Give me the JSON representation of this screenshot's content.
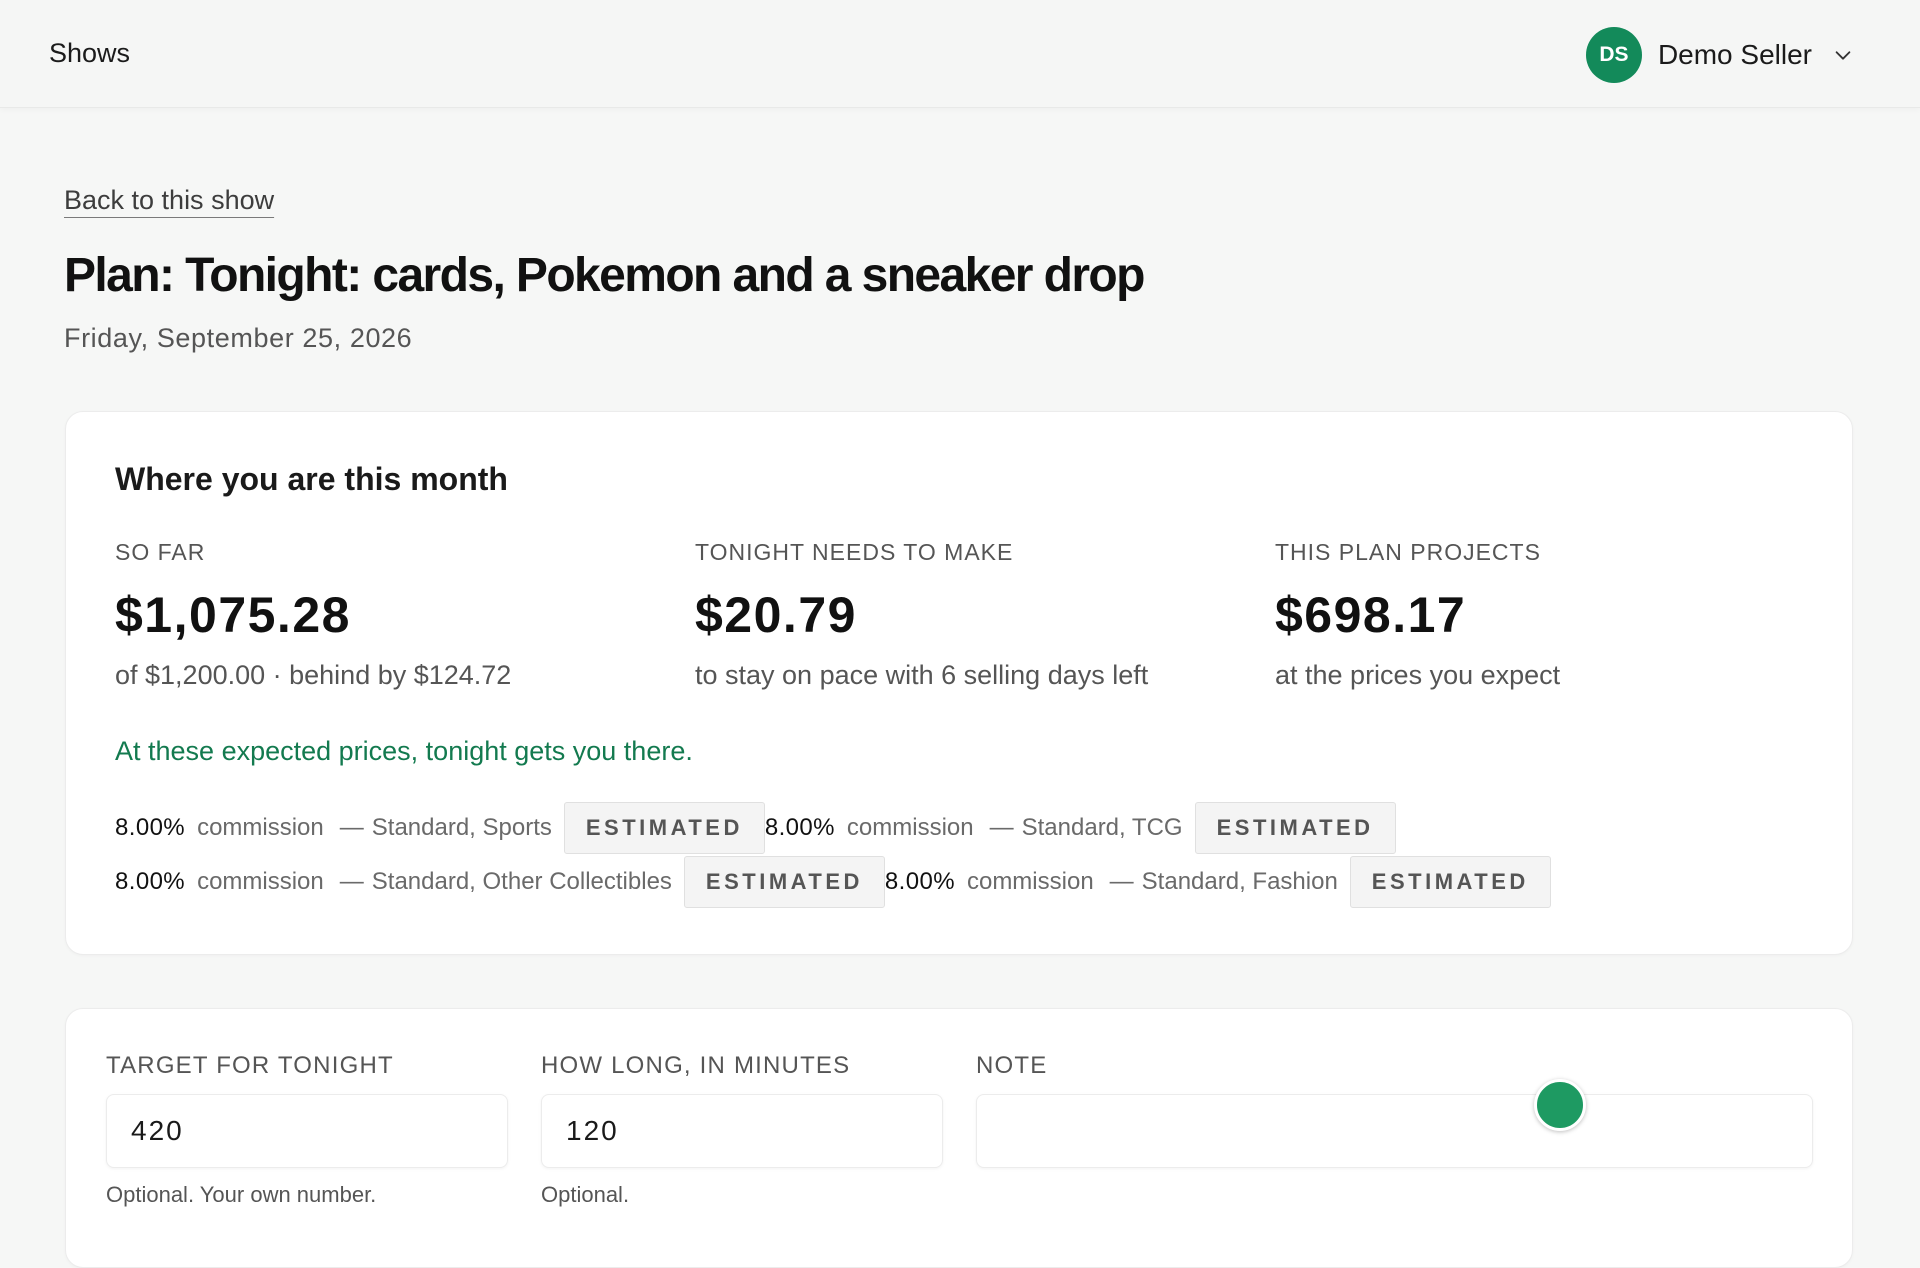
{
  "topbar": {
    "nav_label": "Shows",
    "user": {
      "initials": "DS",
      "name": "Demo Seller"
    },
    "colors": {
      "avatar": "#138a5a"
    }
  },
  "page": {
    "back_link": "Back to this show",
    "title": "Plan: Tonight: cards, Pokemon and a sneaker drop",
    "date": "Friday, September 25, 2026"
  },
  "month": {
    "heading": "Where you are this month",
    "stats": [
      {
        "label": "SO FAR",
        "value": "$1,075.28",
        "sub": "of $1,200.00 · behind by $124.72"
      },
      {
        "label": "TONIGHT NEEDS TO MAKE",
        "value": "$20.79",
        "sub": "to stay on pace with 6 selling days left"
      },
      {
        "label": "THIS PLAN PROJECTS",
        "value": "$698.17",
        "sub": "at the prices you expect"
      }
    ],
    "status": "At these expected prices, tonight gets you there.",
    "status_color": "#137a4f",
    "commissions": [
      {
        "pct": "8.00%",
        "word": "commission",
        "dash": "—",
        "category": "Standard, Sports",
        "badge": "ESTIMATED"
      },
      {
        "pct": "8.00%",
        "word": "commission",
        "dash": "—",
        "category": "Standard, TCG",
        "badge": "ESTIMATED"
      },
      {
        "pct": "8.00%",
        "word": "commission",
        "dash": "—",
        "category": "Standard, Other Collectibles",
        "badge": "ESTIMATED"
      },
      {
        "pct": "8.00%",
        "word": "commission",
        "dash": "—",
        "category": "Standard, Fashion",
        "badge": "ESTIMATED"
      }
    ]
  },
  "form": {
    "target": {
      "label": "TARGET FOR TONIGHT",
      "value": "420",
      "help": "Optional. Your own number."
    },
    "duration": {
      "label": "HOW LONG, IN MINUTES",
      "value": "120",
      "help": "Optional."
    },
    "note": {
      "label": "NOTE",
      "value": ""
    }
  },
  "icons": {
    "user_menu": "chevron-down-icon",
    "drag_handle": "drag-handle"
  }
}
